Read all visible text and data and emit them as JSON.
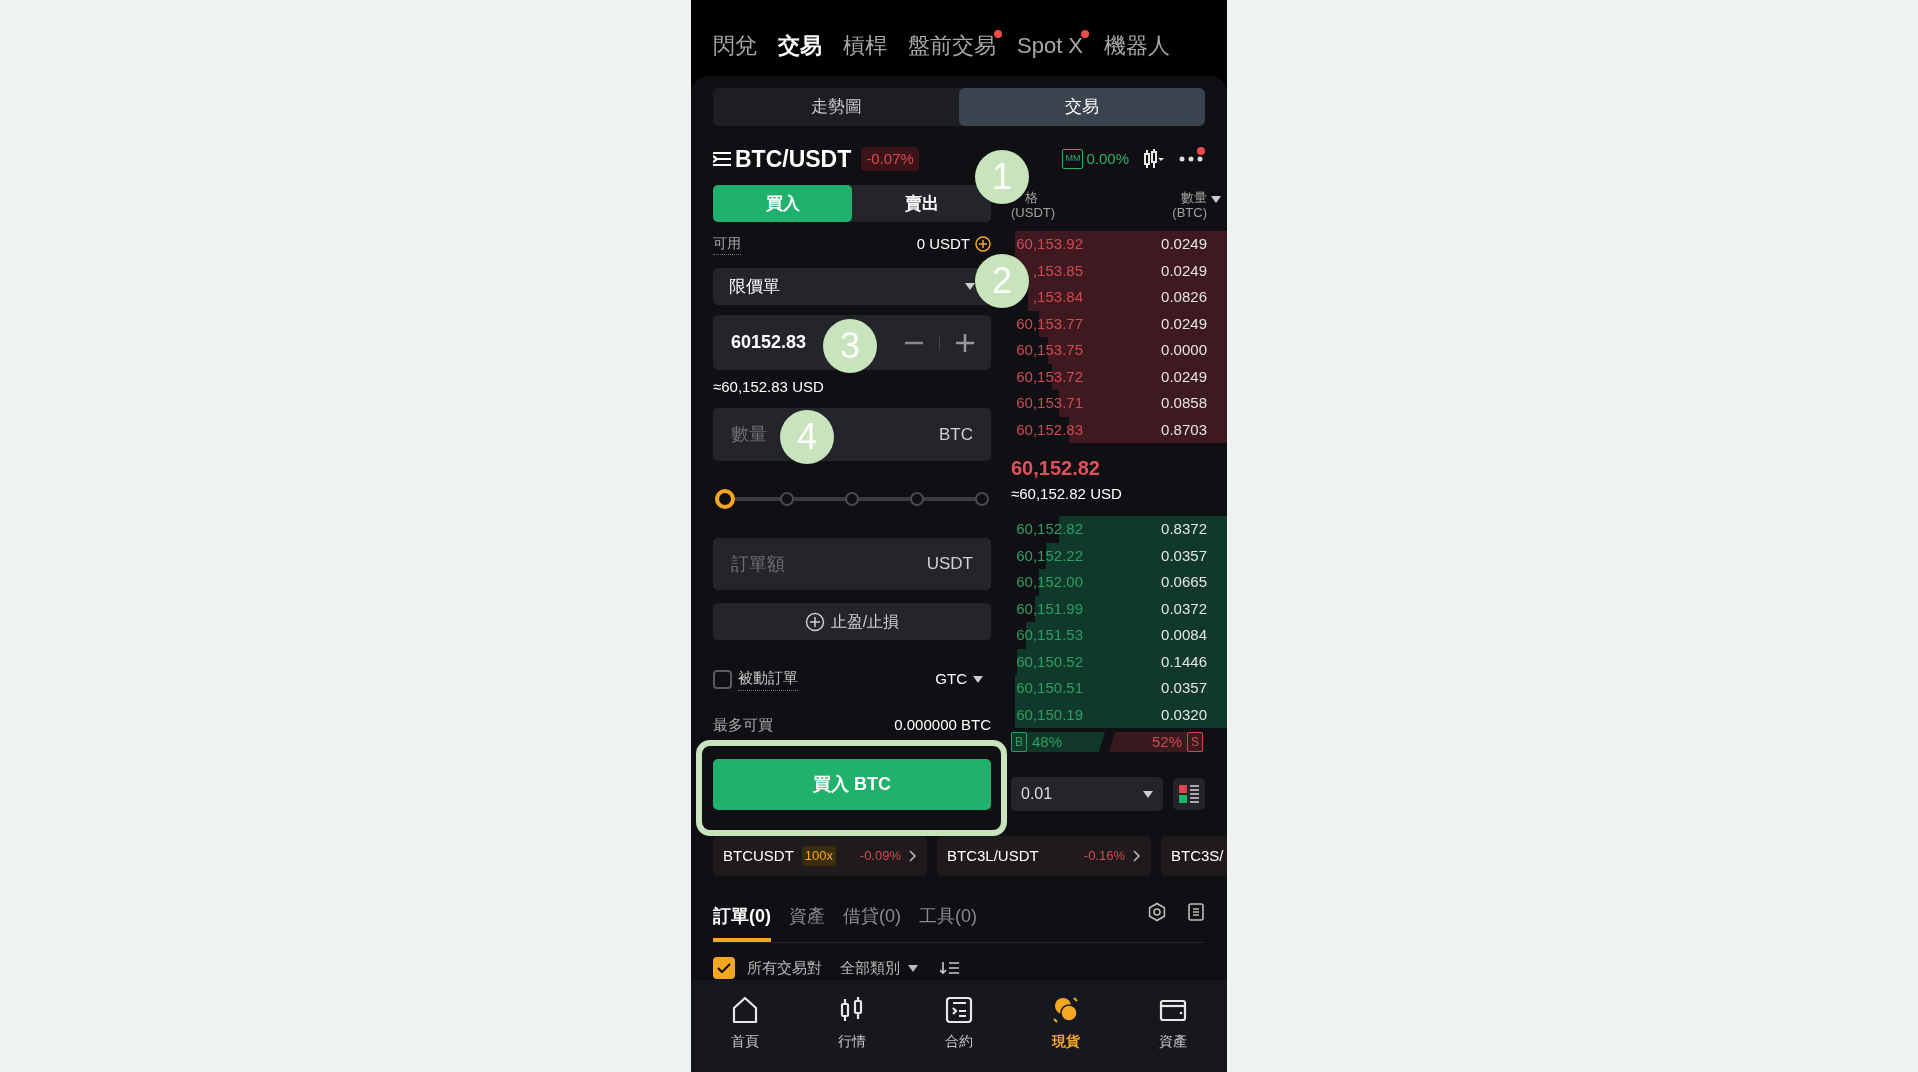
{
  "top_tabs": [
    {
      "label": "閃兌",
      "selected": false,
      "dot": false
    },
    {
      "label": "交易",
      "selected": true,
      "dot": false
    },
    {
      "label": "槓桿",
      "selected": false,
      "dot": false
    },
    {
      "label": "盤前交易",
      "selected": false,
      "dot": true
    },
    {
      "label": "Spot X",
      "selected": false,
      "dot": true
    },
    {
      "label": "機器人",
      "selected": false,
      "dot": false
    }
  ],
  "view_toggle": [
    {
      "label": "走勢圖",
      "selected": false
    },
    {
      "label": "交易",
      "selected": true
    }
  ],
  "pair": {
    "symbol": "BTC/USDT",
    "change": "-0.07%",
    "mm_label": "MM",
    "mm_value": "0.00%",
    "more_dot": true
  },
  "side_tabs": [
    {
      "label": "買入",
      "selected": true
    },
    {
      "label": "賣出",
      "selected": false
    }
  ],
  "available": {
    "label": "可用",
    "value": "0 USDT"
  },
  "order_type": {
    "value": "限價單"
  },
  "price": {
    "value": "60152.83",
    "usd": "≈60,152.83 USD"
  },
  "quantity": {
    "placeholder": "數量",
    "unit": "BTC"
  },
  "slider": {
    "level": 0
  },
  "amount": {
    "placeholder": "訂單額",
    "unit": "USDT"
  },
  "tpsl_button": "止盈/止損",
  "passive": {
    "label": "被動訂單",
    "checked": false,
    "tif": "GTC"
  },
  "max_buy": {
    "label": "最多可買",
    "value": "0.000000 BTC"
  },
  "buy_button": "買入 BTC",
  "order_book": {
    "price_header": [
      "格",
      "(USDT)"
    ],
    "qty_header": [
      "數量",
      "(BTC)"
    ],
    "asks": [
      {
        "price": "60,153.92",
        "qty": "0.0249",
        "level": 0.98
      },
      {
        "price": ",153.85",
        "qty": "0.0249",
        "level": 0.98
      },
      {
        "price": ",153.84",
        "qty": "0.0826",
        "level": 0.92
      },
      {
        "price": "60,153.77",
        "qty": "0.0249",
        "level": 0.87
      },
      {
        "price": "60,153.75",
        "qty": "0.0000",
        "level": 0.83
      },
      {
        "price": "60,153.72",
        "qty": "0.0249",
        "level": 0.81
      },
      {
        "price": "60,153.71",
        "qty": "0.0858",
        "level": 0.78
      },
      {
        "price": "60,152.83",
        "qty": "0.8703",
        "level": 0.73
      }
    ],
    "last_price": "60,152.82",
    "last_usd": "≈60,152.82 USD",
    "bids": [
      {
        "price": "60,152.82",
        "qty": "0.8372",
        "level": 0.78
      },
      {
        "price": "60,152.22",
        "qty": "0.0357",
        "level": 0.84
      },
      {
        "price": "60,152.00",
        "qty": "0.0665",
        "level": 0.87
      },
      {
        "price": "60,151.99",
        "qty": "0.0372",
        "level": 0.89
      },
      {
        "price": "60,151.53",
        "qty": "0.0084",
        "level": 0.93
      },
      {
        "price": "60,150.52",
        "qty": "0.1446",
        "level": 0.97
      },
      {
        "price": "60,150.51",
        "qty": "0.0357",
        "level": 0.98
      },
      {
        "price": "60,150.19",
        "qty": "0.0320",
        "level": 0.98
      }
    ],
    "buy_label": "B",
    "buy_ratio": "48%",
    "sell_ratio": "52%",
    "sell_label": "S",
    "depth": "0.01"
  },
  "tickers": [
    {
      "symbol": "BTCUSDT",
      "leverage": "100x",
      "change": "-0.09%"
    },
    {
      "symbol": "BTC3L/USDT",
      "change": "-0.16%"
    },
    {
      "symbol": "BTC3S/"
    }
  ],
  "bottom_tabs": [
    {
      "label": "訂單(0)",
      "selected": true
    },
    {
      "label": "資產",
      "selected": false
    },
    {
      "label": "借貸(0)",
      "selected": false
    },
    {
      "label": "工具(0)",
      "selected": false
    }
  ],
  "filter": {
    "checked": true,
    "label": "所有交易對",
    "category": "全部類別"
  },
  "nav": [
    {
      "label": "首頁",
      "selected": false
    },
    {
      "label": "行情",
      "selected": false
    },
    {
      "label": "合約",
      "selected": false
    },
    {
      "label": "現貨",
      "selected": true
    },
    {
      "label": "資產",
      "selected": false
    }
  ],
  "annotations": [
    {
      "label": "1"
    },
    {
      "label": "2"
    },
    {
      "label": "3"
    },
    {
      "label": "4"
    }
  ]
}
